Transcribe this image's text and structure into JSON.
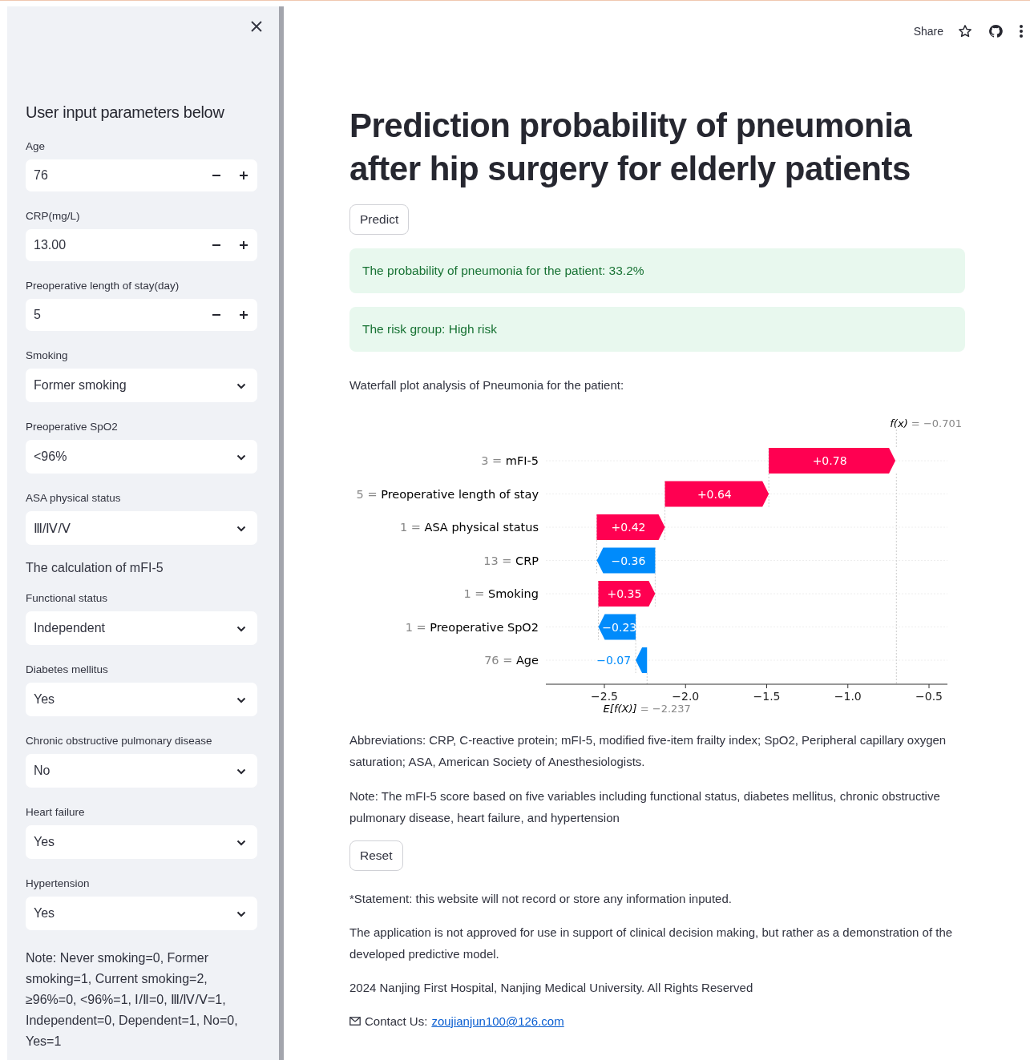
{
  "header": {
    "share": "Share"
  },
  "sidebar": {
    "title": "User input parameters below",
    "fields": [
      {
        "kind": "number",
        "label": "Age",
        "value": "76"
      },
      {
        "kind": "number",
        "label": "CRP(mg/L)",
        "value": "13.00"
      },
      {
        "kind": "number",
        "label": "Preoperative length of stay(day)",
        "value": "5"
      },
      {
        "kind": "select",
        "label": "Smoking",
        "value": "Former smoking"
      },
      {
        "kind": "select",
        "label": "Preoperative SpO2",
        "value": "<96%"
      },
      {
        "kind": "select",
        "label": "ASA physical status",
        "value": "Ⅲ/Ⅳ/Ⅴ"
      },
      {
        "kind": "heading",
        "label": "The calculation of mFI-5"
      },
      {
        "kind": "select",
        "label": "Functional status",
        "value": "Independent"
      },
      {
        "kind": "select",
        "label": "Diabetes mellitus",
        "value": "Yes"
      },
      {
        "kind": "select",
        "label": "Chronic obstructive pulmonary disease",
        "value": "No"
      },
      {
        "kind": "select",
        "label": "Heart failure",
        "value": "Yes"
      },
      {
        "kind": "select",
        "label": "Hypertension",
        "value": "Yes"
      }
    ],
    "note": "Note: Never smoking=0, Former smoking=1, Current smoking=2, ≥96%=0, <96%=1, Ⅰ/Ⅱ=0, Ⅲ/Ⅳ/Ⅴ=1, Independent=0, Dependent=1, No=0, Yes=1"
  },
  "main": {
    "title": "Prediction probability of pneumonia after hip surgery for elderly patients",
    "predict_button": "Predict",
    "alerts": [
      "The probability of pneumonia for the patient: 33.2%",
      "The risk group: High risk"
    ],
    "chart_caption": "Waterfall plot analysis of Pneumonia for the patient:",
    "waterfall": {
      "output": {
        "label": "f(x)",
        "text": "= −0.701"
      },
      "rows": [
        {
          "feature": "3 = mFI-5",
          "contribution": "+0.78"
        },
        {
          "feature": "5 = Preoperative length of stay",
          "contribution": "+0.64"
        },
        {
          "feature": "1 = ASA physical status",
          "contribution": "+0.42"
        },
        {
          "feature": "13 = CRP",
          "contribution": "−0.36"
        },
        {
          "feature": "1 = Smoking",
          "contribution": "+0.35"
        },
        {
          "feature": "1 = Preoperative SpO2",
          "contribution": "−0.23"
        },
        {
          "feature": "76 = Age",
          "contribution": "−0.07"
        }
      ],
      "ticks": [
        "−2.5",
        "−2.0",
        "−1.5",
        "−1.0",
        "−0.5"
      ],
      "base": {
        "label": "E[f(X)]",
        "text": "= −2.237"
      }
    },
    "paragraphs": [
      "Abbreviations: CRP, C-reactive protein; mFI-5, modified five-item frailty index; SpO2, Peripheral capillary oxygen saturation; ASA, American Society of Anesthesiologists.",
      "Note: The mFI-5 score based on five variables including functional status, diabetes mellitus, chronic obstructive pulmonary disease, heart failure, and hypertension"
    ],
    "reset_button": "Reset",
    "footer": [
      "*Statement: this website will not record or store any information inputed.",
      "The application is not approved for use in support of clinical decision making, but rather as a demonstration of the developed predictive model.",
      "2024 Nanjing First Hospital, Nanjing Medical University. All Rights Reserved"
    ],
    "contact": {
      "label": "Contact Us:",
      "email": "zoujianjun100@126.com"
    }
  }
}
